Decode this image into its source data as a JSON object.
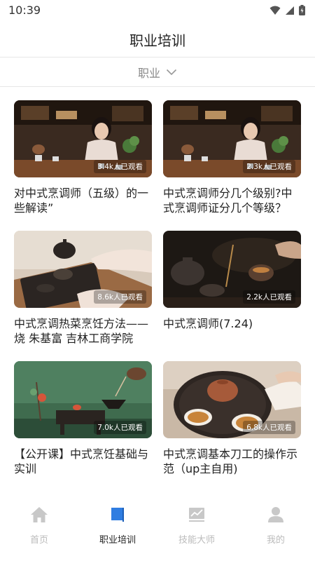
{
  "status": {
    "time": "10:39"
  },
  "header": {
    "title": "职业培训"
  },
  "filter": {
    "label": "职业"
  },
  "colors": {
    "accent": "#2f7de1",
    "inactive": "#c8c8c8"
  },
  "videos": [
    {
      "title": "对中式烹调师（五级）的一些解读”",
      "views": "3.4k人已观看"
    },
    {
      "title": "中式烹调师分几个级别?中式烹调师证分几个等级？",
      "views": "2.3k人已观看"
    },
    {
      "title": "中式烹调热菜烹饪方法——烧 朱基富 吉林工商学院",
      "views": "8.6k人已观看"
    },
    {
      "title": "中式烹调师(7.24)",
      "views": "2.2k人已观看"
    },
    {
      "title": "【公开课】中式烹饪基础与实训",
      "views": "7.0k人已观看"
    },
    {
      "title": "中式烹调基本刀工的操作示范（up主自用)",
      "views": "6.8k人已观看"
    }
  ],
  "tabs": [
    {
      "label": "首页",
      "icon": "home-icon",
      "active": false
    },
    {
      "label": "职业培训",
      "icon": "book-icon",
      "active": true
    },
    {
      "label": "技能大师",
      "icon": "chart-icon",
      "active": false
    },
    {
      "label": "我的",
      "icon": "user-icon",
      "active": false
    }
  ]
}
